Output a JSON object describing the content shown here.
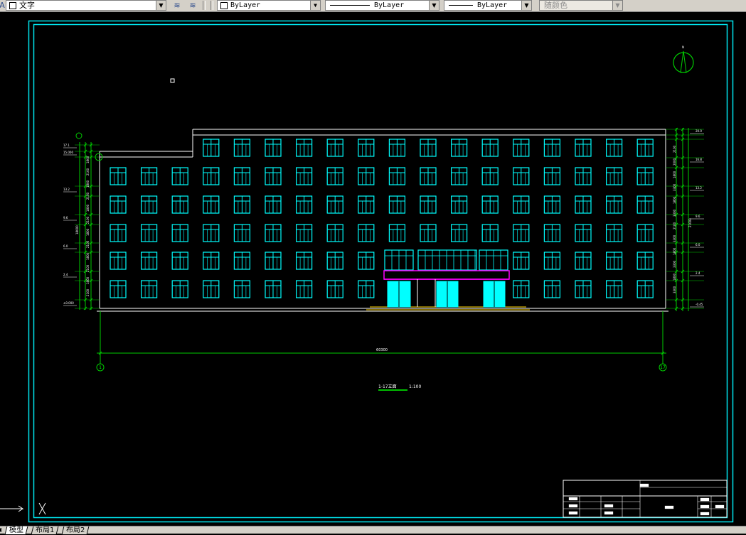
{
  "toolbar": {
    "text_style": "文字",
    "layer": "ByLayer",
    "linetype": "ByLayer",
    "lineweight": "ByLayer",
    "plot_style": "随颜色"
  },
  "tabs": [
    {
      "label": "模型",
      "active": true
    },
    {
      "label": "布局1",
      "active": false
    },
    {
      "label": "布局2",
      "active": false
    }
  ],
  "drawing": {
    "title": "1-17立面",
    "scale": "1:100",
    "total_dim": "60300",
    "axis_left": "1",
    "axis_right": "17",
    "right_dims": [
      "2100",
      "2000",
      "1800",
      "3300",
      "1800",
      "3300",
      "2100",
      "3300",
      "1800",
      "3300",
      "1800",
      "3300"
    ],
    "right_elev": [
      "20.0",
      "16.8",
      "13.2",
      "9.6",
      "6.0",
      "2.4",
      "-0.45"
    ],
    "left_elev": [
      "17.1",
      "15.000",
      "13.2",
      "9.6",
      "6.0",
      "2.4",
      "±0.000"
    ],
    "left_dims": [
      "1800",
      "2100",
      "1800",
      "2100",
      "1800",
      "2100",
      "1800",
      "2100",
      "1800",
      "2100",
      "1800",
      "2100"
    ],
    "left_total": "18000",
    "right_total": "21000"
  },
  "colors": {
    "frame": "#00e5ee",
    "lines": "#ffffff",
    "windows": "#00ffff",
    "dims": "#00cc00",
    "canopy": "#ff00ff",
    "ground": "#ffd400"
  }
}
